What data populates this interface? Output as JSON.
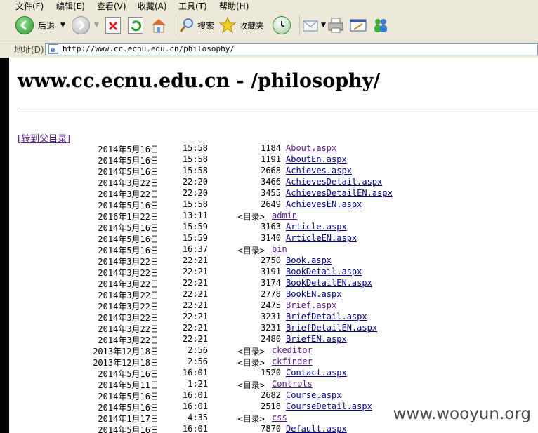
{
  "menu": {
    "items": [
      "文件(F)",
      "编辑(E)",
      "查看(V)",
      "收藏(A)",
      "工具(T)",
      "帮助(H)"
    ]
  },
  "toolbar": {
    "back_label": "后退",
    "search_label": "搜索",
    "favorites_label": "收藏夹"
  },
  "address": {
    "label": "地址(D)",
    "url": "http://www.cc.ecnu.edu.cn/philosophy/"
  },
  "page": {
    "title": "www.cc.ecnu.edu.cn - /philosophy/",
    "parent_link": "[转到父目录]",
    "dir_marker": "<目录>",
    "rows": [
      {
        "date": "2014年5月16日",
        "time": "15:58",
        "size": "1184",
        "name": "About.aspx",
        "dir": false,
        "visited": true
      },
      {
        "date": "2014年5月16日",
        "time": "15:58",
        "size": "1191",
        "name": "AboutEn.aspx",
        "dir": false,
        "visited": false
      },
      {
        "date": "2014年5月16日",
        "time": "15:58",
        "size": "2668",
        "name": "Achieves.aspx",
        "dir": false,
        "visited": false
      },
      {
        "date": "2014年3月22日",
        "time": "22:20",
        "size": "3466",
        "name": "AchievesDetail.aspx",
        "dir": false,
        "visited": false
      },
      {
        "date": "2014年3月22日",
        "time": "22:20",
        "size": "3455",
        "name": "AchievesDetailEN.aspx",
        "dir": false,
        "visited": false
      },
      {
        "date": "2014年5月16日",
        "time": "15:58",
        "size": "2649",
        "name": "AchievesEN.aspx",
        "dir": false,
        "visited": false
      },
      {
        "date": "2016年1月22日",
        "time": "13:11",
        "size": "",
        "name": "admin",
        "dir": true,
        "visited": true
      },
      {
        "date": "2014年5月16日",
        "time": "15:59",
        "size": "3163",
        "name": "Article.aspx",
        "dir": false,
        "visited": false
      },
      {
        "date": "2014年5月16日",
        "time": "15:59",
        "size": "3140",
        "name": "ArticleEN.aspx",
        "dir": false,
        "visited": false
      },
      {
        "date": "2014年5月16日",
        "time": "16:37",
        "size": "",
        "name": "bin",
        "dir": true,
        "visited": true
      },
      {
        "date": "2014年3月22日",
        "time": "22:21",
        "size": "2750",
        "name": "Book.aspx",
        "dir": false,
        "visited": false
      },
      {
        "date": "2014年3月22日",
        "time": "22:21",
        "size": "3191",
        "name": "BookDetail.aspx",
        "dir": false,
        "visited": false
      },
      {
        "date": "2014年3月22日",
        "time": "22:21",
        "size": "3174",
        "name": "BookDetailEN.aspx",
        "dir": false,
        "visited": false
      },
      {
        "date": "2014年3月22日",
        "time": "22:21",
        "size": "2778",
        "name": "BookEN.aspx",
        "dir": false,
        "visited": false
      },
      {
        "date": "2014年3月22日",
        "time": "22:21",
        "size": "2475",
        "name": "Brief.aspx",
        "dir": false,
        "visited": true
      },
      {
        "date": "2014年3月22日",
        "time": "22:21",
        "size": "3231",
        "name": "BriefDetail.aspx",
        "dir": false,
        "visited": false
      },
      {
        "date": "2014年3月22日",
        "time": "22:21",
        "size": "3231",
        "name": "BriefDetailEN.aspx",
        "dir": false,
        "visited": false
      },
      {
        "date": "2014年3月22日",
        "time": "22:21",
        "size": "2480",
        "name": "BriefEN.aspx",
        "dir": false,
        "visited": false
      },
      {
        "date": "2013年12月18日",
        "time": "2:56",
        "size": "",
        "name": "ckeditor",
        "dir": true,
        "visited": true
      },
      {
        "date": "2013年12月18日",
        "time": "2:56",
        "size": "",
        "name": "ckfinder",
        "dir": true,
        "visited": true
      },
      {
        "date": "2014年5月16日",
        "time": "16:01",
        "size": "1520",
        "name": "Contact.aspx",
        "dir": false,
        "visited": false
      },
      {
        "date": "2014年5月11日",
        "time": "1:21",
        "size": "",
        "name": "Controls",
        "dir": true,
        "visited": true
      },
      {
        "date": "2014年5月16日",
        "time": "16:01",
        "size": "2682",
        "name": "Course.aspx",
        "dir": false,
        "visited": false
      },
      {
        "date": "2014年5月16日",
        "time": "16:01",
        "size": "2518",
        "name": "CourseDetail.aspx",
        "dir": false,
        "visited": false
      },
      {
        "date": "2014年1月17日",
        "time": "4:35",
        "size": "",
        "name": "css",
        "dir": true,
        "visited": true
      },
      {
        "date": "2014年5月16日",
        "time": "16:01",
        "size": "7870",
        "name": "Default.aspx",
        "dir": false,
        "visited": false
      }
    ]
  },
  "watermark": "www.wooyun.org"
}
